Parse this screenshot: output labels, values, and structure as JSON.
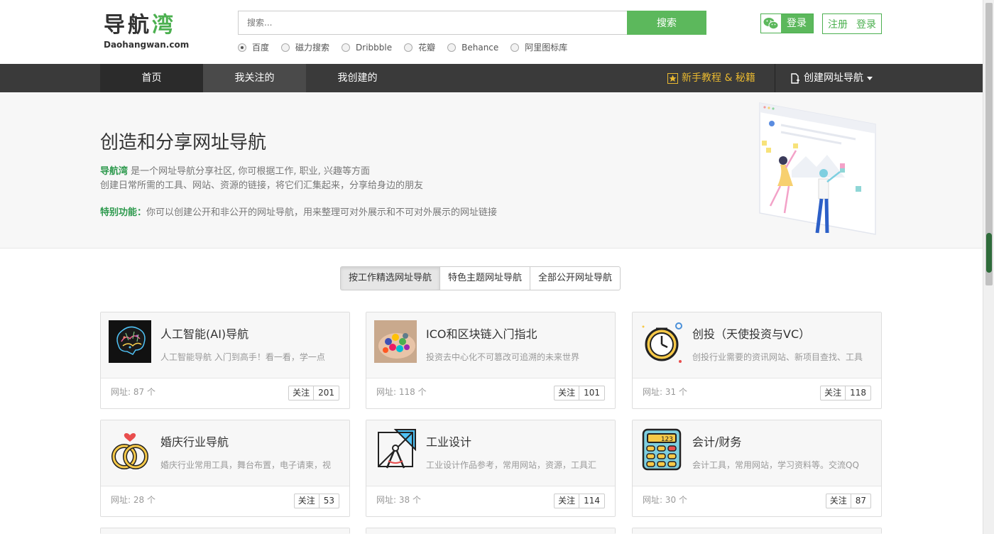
{
  "logo": {
    "cn_dark": "导航",
    "cn_green": "湾",
    "en": "Daohangwan.com"
  },
  "search": {
    "placeholder": "搜索...",
    "button": "搜索"
  },
  "engines": [
    "百度",
    "磁力搜索",
    "Dribbble",
    "花瓣",
    "Behance",
    "阿里图标库"
  ],
  "auth": {
    "wechat_login": "登录",
    "register": "注册",
    "login": "登录"
  },
  "nav": {
    "home": "首页",
    "following": "我关注的",
    "created": "我创建的",
    "tutorial": "新手教程 & 秘籍",
    "create": "创建网址导航"
  },
  "hero": {
    "title": "创造和分享网址导航",
    "line1_hl": "导航湾",
    "line1": " 是一个网址导航分享社区, 你可根据工作, 职业, 兴趣等方面",
    "line2": "创建日常所需的工具、网站、资源的链接，将它们汇集起来，分享给身边的朋友",
    "line3_hl": "特别功能：",
    "line3": "你可以创建公开和非公开的网址导航，用来整理可对外展示和不可对外展示的网址链接"
  },
  "tabs": [
    "按工作精选网址导航",
    "特色主题网址导航",
    "全部公开网址导航"
  ],
  "cards": [
    {
      "title": "人工智能(AI)导航",
      "desc": "人工智能导航 入门到高手！看一看，学一点",
      "count": "网址: 87 个",
      "follow": "关注",
      "followers": "201",
      "icon": "brain-icon"
    },
    {
      "title": "ICO和区块链入门指北",
      "desc": "投资去中心化不可篡改可追溯的未来世界",
      "count": "网址: 118 个",
      "follow": "关注",
      "followers": "101",
      "icon": "coins-icon"
    },
    {
      "title": "创投（天使投资与VC）",
      "desc": "创投行业需要的资讯网站、新项目查找、工具",
      "count": "网址: 31 个",
      "follow": "关注",
      "followers": "118",
      "icon": "clock-icon"
    },
    {
      "title": "婚庆行业导航",
      "desc": "婚庆行业常用工具，舞台布置，电子请柬，视",
      "count": "网址: 28 个",
      "follow": "关注",
      "followers": "53",
      "icon": "rings-icon"
    },
    {
      "title": "工业设计",
      "desc": "工业设计作品参考，常用网站，资源，工具汇",
      "count": "网址: 38 个",
      "follow": "关注",
      "followers": "114",
      "icon": "compass-icon"
    },
    {
      "title": "会计/财务",
      "desc": "会计工具，常用网站，学习资料等。交流QQ",
      "count": "网址: 30 个",
      "follow": "关注",
      "followers": "87",
      "icon": "calculator-icon"
    }
  ],
  "calculator_display": "123"
}
